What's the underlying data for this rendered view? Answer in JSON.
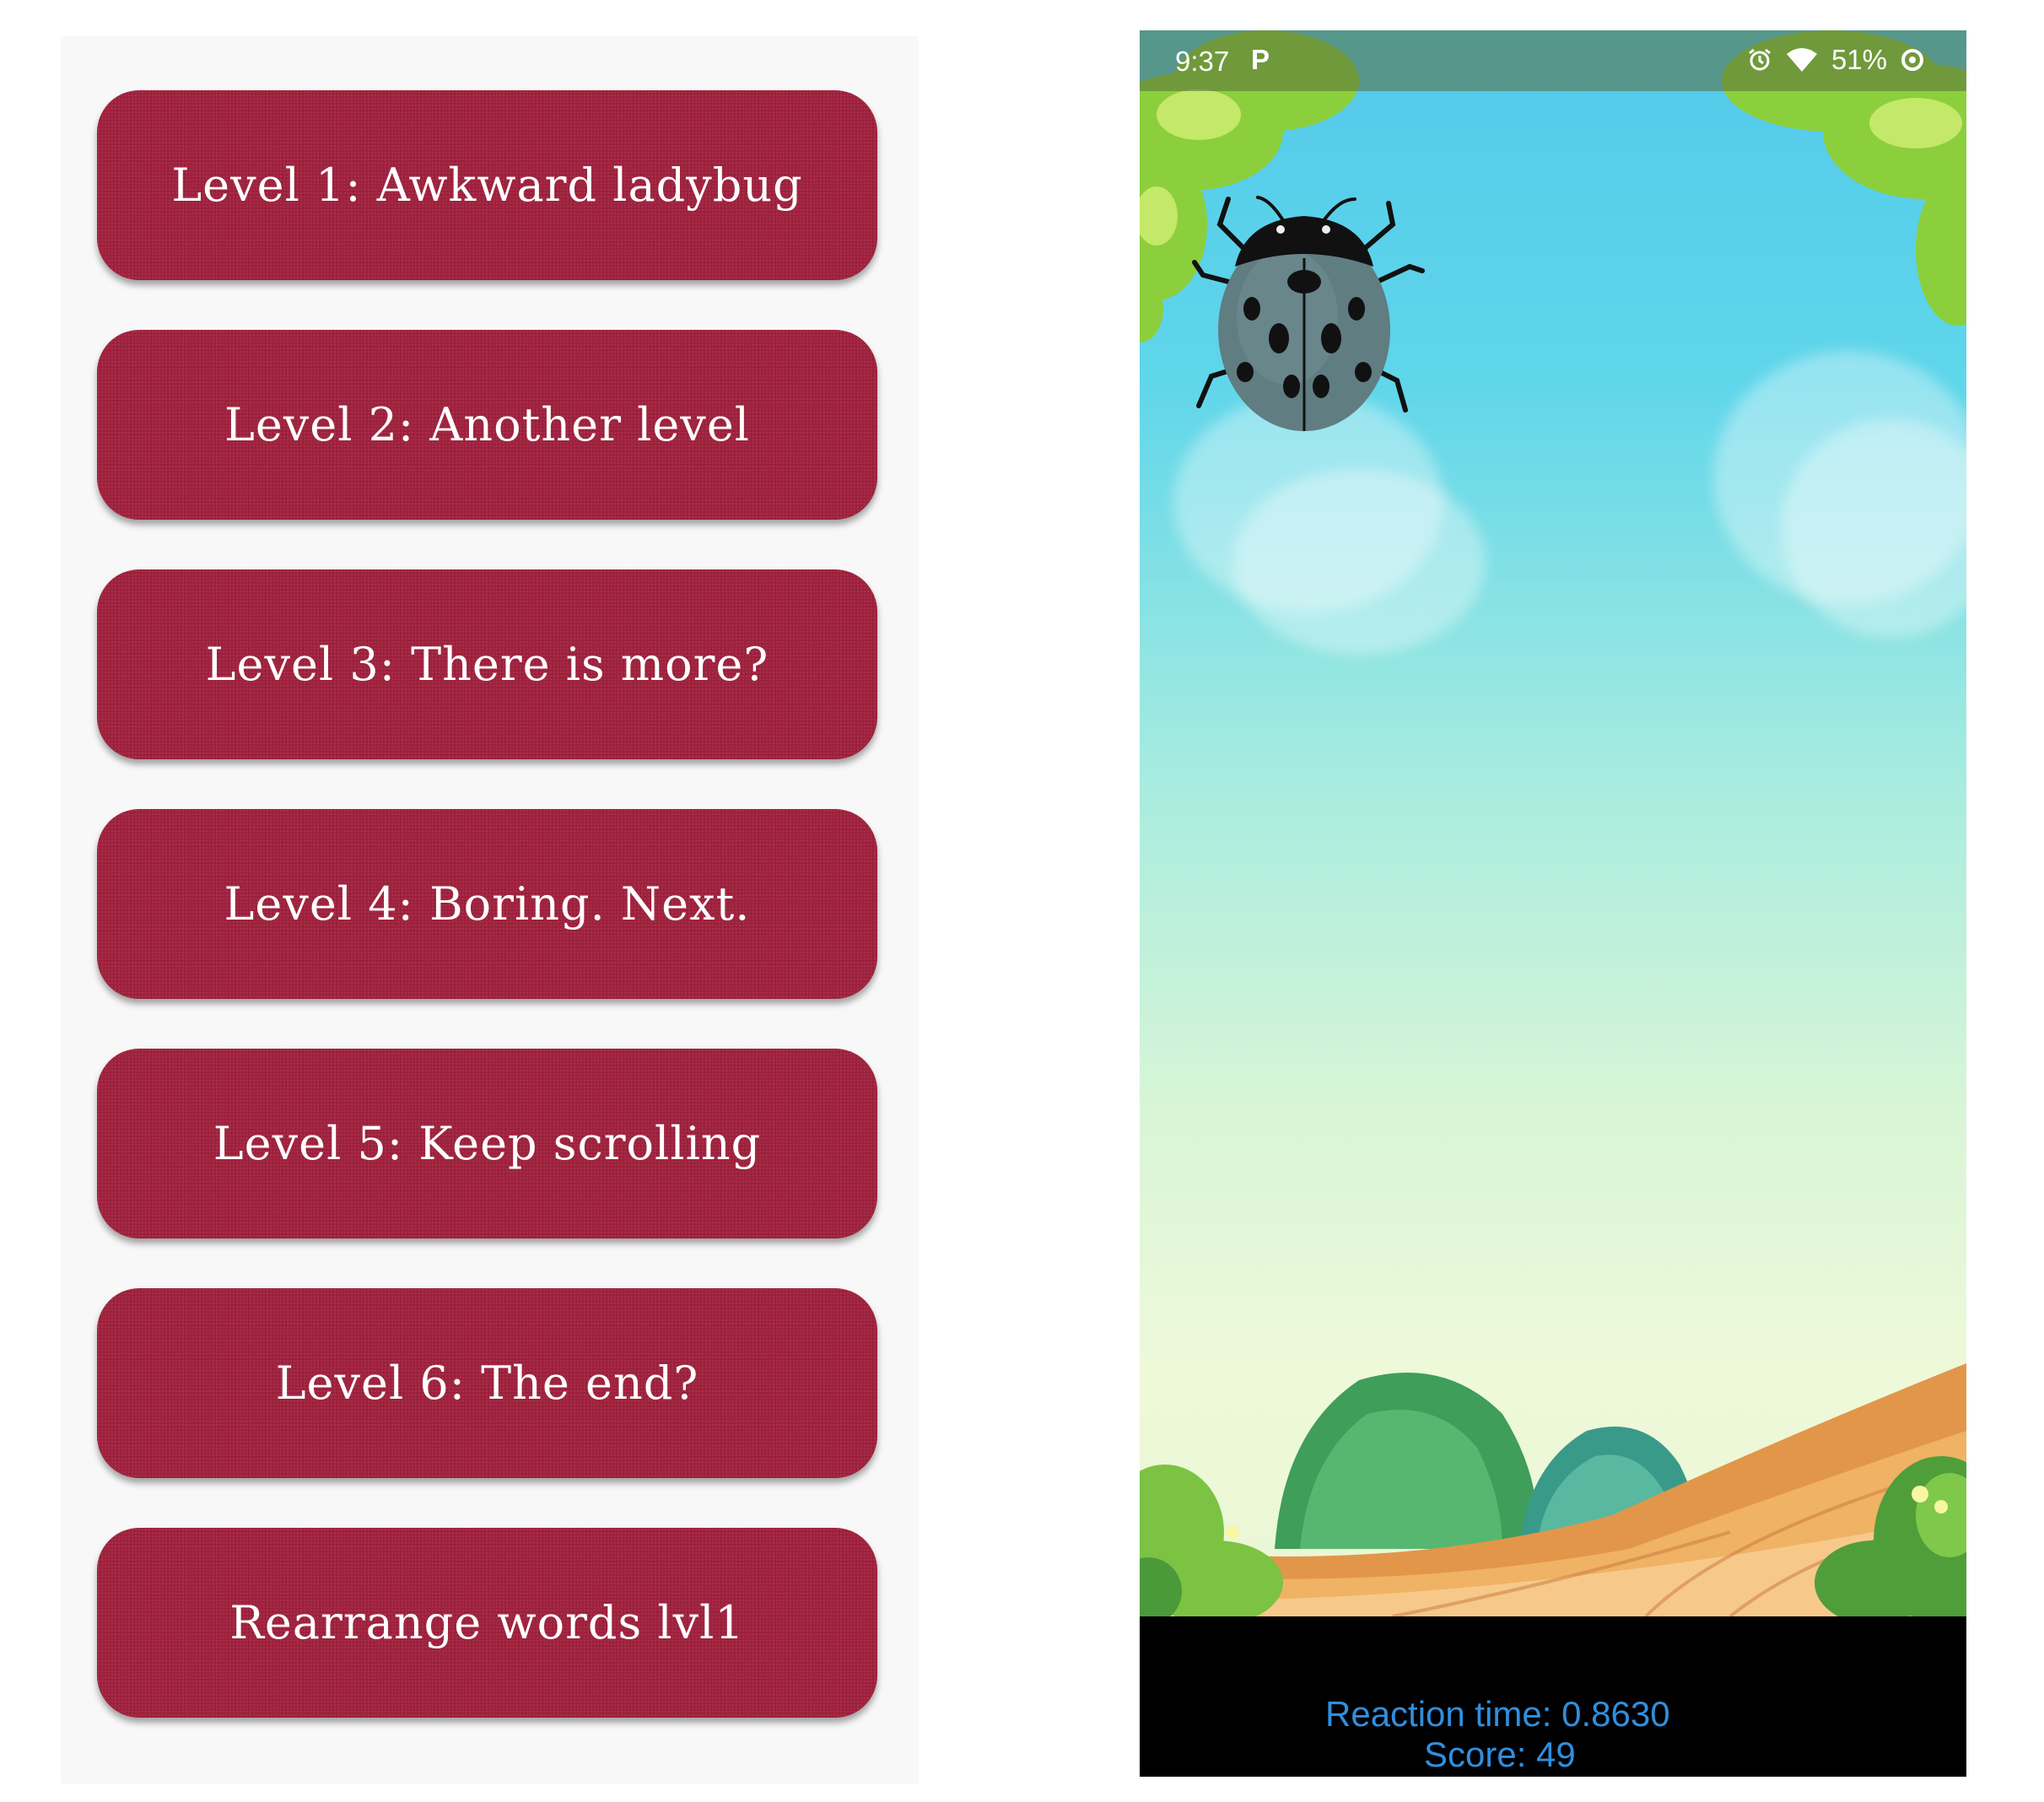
{
  "menu": {
    "levels": [
      "Level 1: Awkward ladybug",
      "Level 2: Another level",
      "Level 3: There is more?",
      "Level 4: Boring. Next.",
      "Level 5: Keep scrolling",
      "Level 6: The end?",
      "Rearrange words lvl1"
    ]
  },
  "game": {
    "status_bar": {
      "time": "9:37",
      "notification_icon": "parking-p-icon",
      "icons": [
        "alarm-icon",
        "wifi-icon",
        "battery-saver-icon"
      ],
      "battery": "51%"
    },
    "reaction_text": "Reaction time: 0.8630",
    "score_text": "Score: 49"
  },
  "colors": {
    "button_bg": "#a0213d",
    "menu_bg": "#f8f8f8",
    "score_text": "#2f8fde",
    "ladybug_shell": "#607d82"
  }
}
